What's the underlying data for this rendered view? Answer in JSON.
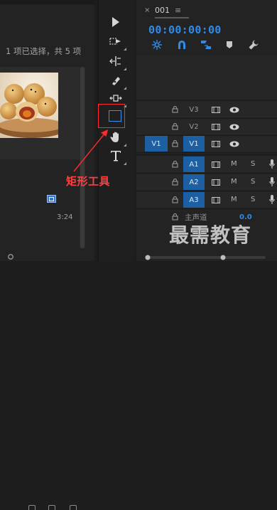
{
  "project_panel": {
    "selection_info": "1 项已选择，共 5 项",
    "clip_duration": "3:24"
  },
  "tools": {
    "items": [
      "selection-tool-icon",
      "track-select-tool-icon",
      "ripple-edit-tool-icon",
      "razor-tool-icon",
      "slip-tool-icon",
      "rectangle-tool-icon",
      "hand-tool-icon",
      "type-tool-icon"
    ],
    "highlight_color": "#ff2a2a",
    "active_color": "#3c8ff2"
  },
  "annotation": {
    "label": "矩形工具"
  },
  "timeline": {
    "close_glyph": "×",
    "sequence_name": "001",
    "menu_glyph": "≡",
    "timecode": "00:00:00:00",
    "accent_color": "#2d8ceb",
    "video_tracks": [
      {
        "name": "V3",
        "targeted": false
      },
      {
        "name": "V2",
        "targeted": false
      },
      {
        "name": "V1",
        "targeted": true,
        "source": "V1"
      }
    ],
    "audio_tracks": [
      {
        "name": "A1",
        "m": "M",
        "s": "S"
      },
      {
        "name": "A2",
        "m": "M",
        "s": "S"
      },
      {
        "name": "A3",
        "m": "M",
        "s": "S"
      }
    ],
    "master": {
      "label": "主声道",
      "value": "0.0"
    }
  },
  "watermark": "最需教育"
}
